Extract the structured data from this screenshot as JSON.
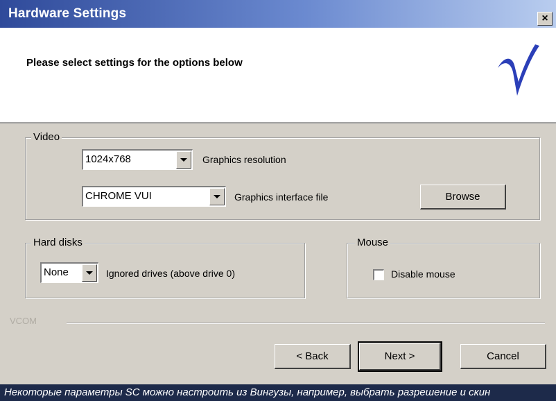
{
  "window": {
    "title": "Hardware Settings",
    "close_label": "×"
  },
  "header": {
    "text": "Please select settings for the options below",
    "logo_icon": "v-logo-icon"
  },
  "video": {
    "legend": "Video",
    "resolution": {
      "value": "1024x768",
      "label": "Graphics resolution"
    },
    "interface": {
      "value": "CHROME VUI",
      "label": "Graphics interface file"
    },
    "browse_label": "Browse"
  },
  "hard_disks": {
    "legend": "Hard disks",
    "value": "None",
    "label": "Ignored drives (above drive 0)"
  },
  "mouse": {
    "legend": "Mouse",
    "disable_label": "Disable mouse",
    "disable_checked": false
  },
  "footer": {
    "group_label": "VCOM",
    "back_label": "< Back",
    "next_label": "Next >",
    "cancel_label": "Cancel"
  },
  "caption": "Некоторые параметры SC можно настроить из Вингузы, например, выбрать разрешение и скин",
  "colors": {
    "titlebar_start": "#2f4a9a",
    "titlebar_end": "#b9cdef",
    "dialog_bg": "#d4d0c8",
    "logo": "#2b3fb8",
    "caption_bg": "#1d2a4a"
  }
}
